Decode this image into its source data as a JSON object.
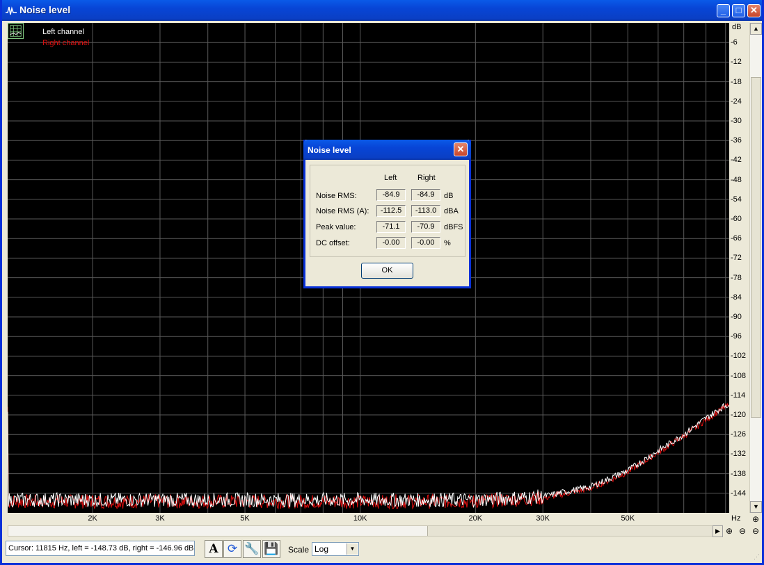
{
  "window": {
    "title": "Noise level"
  },
  "legend": {
    "left_label": "Left channel",
    "right_label": "Right channel"
  },
  "y_axis": {
    "unit": "dB",
    "ticks": [
      "-6",
      "-12",
      "-18",
      "-24",
      "-30",
      "-36",
      "-42",
      "-48",
      "-54",
      "-60",
      "-66",
      "-72",
      "-78",
      "-84",
      "-90",
      "-96",
      "-102",
      "-108",
      "-114",
      "-120",
      "-126",
      "-132",
      "-138",
      "-144"
    ]
  },
  "x_axis": {
    "unit": "Hz",
    "ticks": [
      "2K",
      "3K",
      "5K",
      "10K",
      "20K",
      "30K",
      "50K"
    ]
  },
  "status": {
    "cursor_text": "Cursor:  11815 Hz,  left = -148.73 dB,  right = -146.96 dB"
  },
  "toolbar": {
    "scale_label": "Scale",
    "scale_value": "Log"
  },
  "dialog": {
    "title": "Noise level",
    "col_left": "Left",
    "col_right": "Right",
    "rows": [
      {
        "label": "Noise RMS:",
        "left": "-84.9",
        "right": "-84.9",
        "unit": "dB"
      },
      {
        "label": "Noise RMS (A):",
        "left": "-112.5",
        "right": "-113.0",
        "unit": "dBA"
      },
      {
        "label": "Peak value:",
        "left": "-71.1",
        "right": "-70.9",
        "unit": "dBFS"
      },
      {
        "label": "DC offset:",
        "left": "-0.00",
        "right": "-0.00",
        "unit": "%"
      }
    ],
    "ok_label": "OK"
  },
  "colors": {
    "left_trace": "#ffffff",
    "right_trace": "#e01010",
    "grid": "#5a5a5a",
    "background": "#000000"
  },
  "chart_data": {
    "type": "line",
    "xscale": "log",
    "xlim": [
      1200,
      92000
    ],
    "ylim": [
      -150,
      0
    ],
    "grid": true,
    "legend_position": "top-left",
    "series": [
      {
        "name": "Left channel",
        "x": [
          1200,
          5000,
          10000,
          20000,
          30000,
          40000,
          50000,
          60000,
          70000,
          80000,
          90000
        ],
        "y": [
          -146,
          -146,
          -146,
          -146,
          -145,
          -142,
          -137,
          -131,
          -126,
          -121,
          -117
        ]
      },
      {
        "name": "Right channel",
        "x": [
          1200,
          5000,
          10000,
          20000,
          30000,
          40000,
          50000,
          60000,
          70000,
          80000,
          90000
        ],
        "y": [
          -146.5,
          -146.5,
          -146.5,
          -146.5,
          -145.5,
          -142.5,
          -137.5,
          -131.5,
          -126.5,
          -121.5,
          -117.5
        ]
      }
    ]
  }
}
